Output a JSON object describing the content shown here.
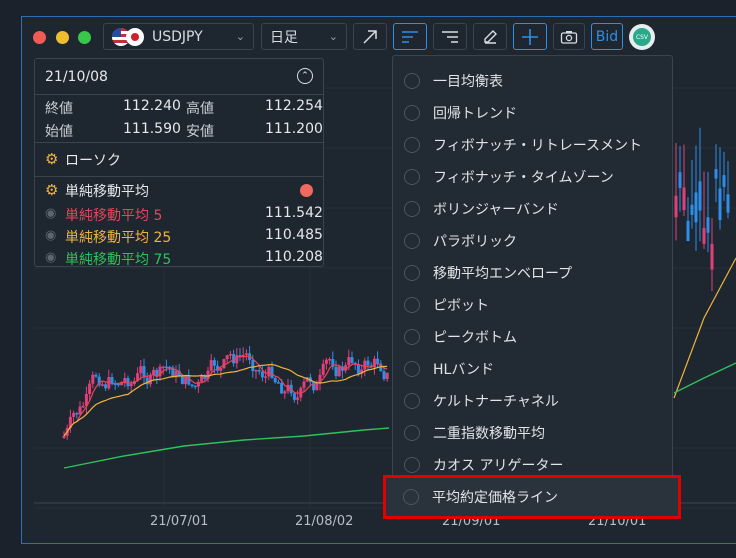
{
  "toolbar": {
    "symbol_label": "USDJPY",
    "timeframe_label": "日足",
    "bid_label": "Bid",
    "csv_label": "CSV"
  },
  "info_panel": {
    "date": "21/10/08",
    "close_label": "終値",
    "close_value": "112.240",
    "high_label": "高値",
    "high_value": "112.254",
    "open_label": "始値",
    "open_value": "111.590",
    "low_label": "安値",
    "low_value": "111.200",
    "candle_label": "ローソク",
    "sma_header": "単純移動平均",
    "sma": [
      {
        "label": "単純移動平均 5",
        "value": "111.542",
        "color": "#e8455a"
      },
      {
        "label": "単純移動平均 25",
        "value": "110.485",
        "color": "#f0b43c"
      },
      {
        "label": "単純移動平均 75",
        "value": "110.208",
        "color": "#2ec25a"
      }
    ]
  },
  "indicator_menu": {
    "items": [
      "一目均衡表",
      "回帰トレンド",
      "フィボナッチ・リトレースメント",
      "フィボナッチ・タイムゾーン",
      "ボリンジャーバンド",
      "パラボリック",
      "移動平均エンベロープ",
      "ピボット",
      "ピークボトム",
      "HLバンド",
      "ケルトナーチャネル",
      "二重指数移動平均",
      "カオス アリゲーター",
      "平均約定価格ライン"
    ],
    "highlighted_index": 13
  },
  "x_axis": {
    "dates": [
      "21/07/01",
      "21/08/02",
      "21/09/01",
      "21/10/01"
    ]
  },
  "colors": {
    "up_candle": "#e0407a",
    "down_candle": "#2f8fe8",
    "ma5": "#e8455a",
    "ma25": "#f0b43c",
    "ma75": "#2ec25a",
    "accent": "#2f8fe8",
    "highlight": "#e00000"
  }
}
